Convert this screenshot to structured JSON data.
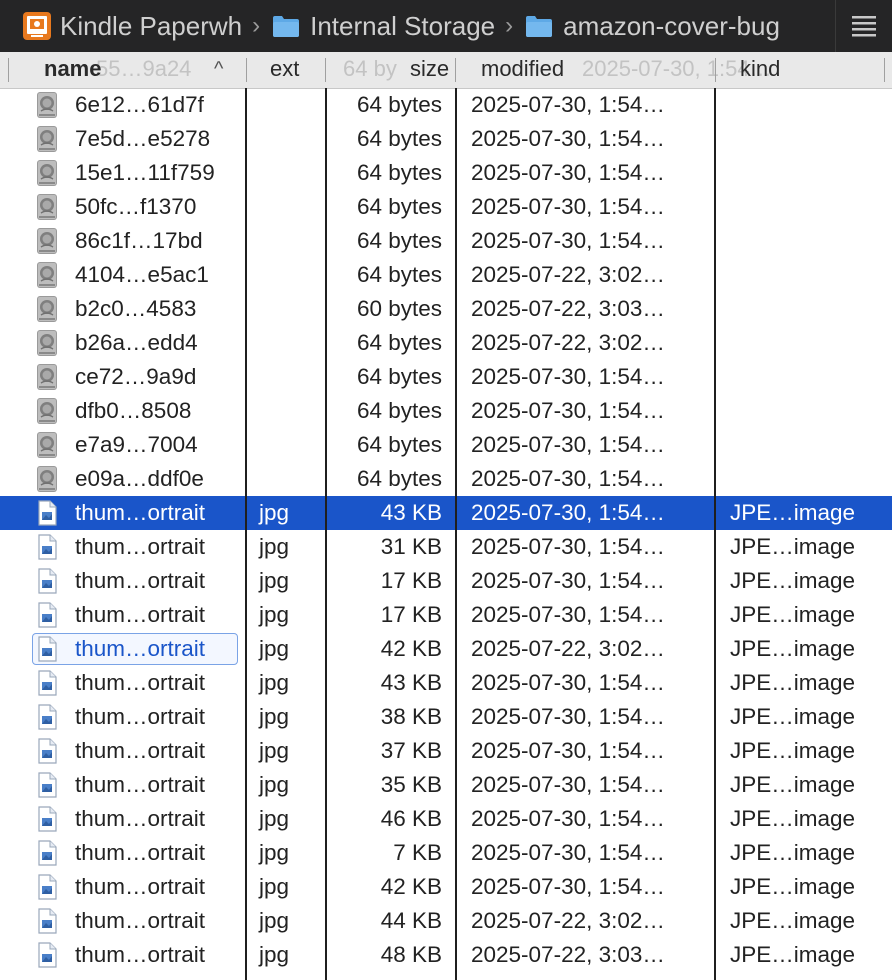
{
  "pathbar": {
    "crumbs": [
      {
        "label": "Kindle Paperwh",
        "icon": "kindle-app-icon"
      },
      {
        "label": "Internal Storage",
        "icon": "folder-icon"
      },
      {
        "label": "amazon-cover-bug",
        "icon": "folder-icon"
      }
    ],
    "separator": "›",
    "view_icon": "list-view-icon"
  },
  "header": {
    "name": "name",
    "sort_indicator": "^",
    "ext": "ext",
    "size": "size",
    "modified": "modified",
    "kind": "kind",
    "behind_name": "55…9a24",
    "behind_size": "64 by",
    "behind_modified": "2025-07-30, 1:54…"
  },
  "colors": {
    "selection": "#1a55c9",
    "pathbar_bg": "#252526",
    "header_bg": "#e9e9e9"
  },
  "rows": [
    {
      "icon": "disk-file-icon",
      "name": "6e12…61d7f",
      "ext": "",
      "size": "64 bytes",
      "modified": "2025-07-30, 1:54…",
      "kind": ""
    },
    {
      "icon": "disk-file-icon",
      "name": "7e5d…e5278",
      "ext": "",
      "size": "64 bytes",
      "modified": "2025-07-30, 1:54…",
      "kind": ""
    },
    {
      "icon": "disk-file-icon",
      "name": "15e1…11f759",
      "ext": "",
      "size": "64 bytes",
      "modified": "2025-07-30, 1:54…",
      "kind": ""
    },
    {
      "icon": "disk-file-icon",
      "name": "50fc…f1370",
      "ext": "",
      "size": "64 bytes",
      "modified": "2025-07-30, 1:54…",
      "kind": ""
    },
    {
      "icon": "disk-file-icon",
      "name": "86c1f…17bd",
      "ext": "",
      "size": "64 bytes",
      "modified": "2025-07-30, 1:54…",
      "kind": ""
    },
    {
      "icon": "disk-file-icon",
      "name": "4104…e5ac1",
      "ext": "",
      "size": "64 bytes",
      "modified": "2025-07-22, 3:02…",
      "kind": ""
    },
    {
      "icon": "disk-file-icon",
      "name": "b2c0…4583",
      "ext": "",
      "size": "60 bytes",
      "modified": "2025-07-22, 3:03…",
      "kind": ""
    },
    {
      "icon": "disk-file-icon",
      "name": "b26a…edd4",
      "ext": "",
      "size": "64 bytes",
      "modified": "2025-07-22, 3:02…",
      "kind": ""
    },
    {
      "icon": "disk-file-icon",
      "name": "ce72…9a9d",
      "ext": "",
      "size": "64 bytes",
      "modified": "2025-07-30, 1:54…",
      "kind": ""
    },
    {
      "icon": "disk-file-icon",
      "name": "dfb0…8508",
      "ext": "",
      "size": "64 bytes",
      "modified": "2025-07-30, 1:54…",
      "kind": ""
    },
    {
      "icon": "disk-file-icon",
      "name": "e7a9…7004",
      "ext": "",
      "size": "64 bytes",
      "modified": "2025-07-30, 1:54…",
      "kind": ""
    },
    {
      "icon": "disk-file-icon",
      "name": "e09a…ddf0e",
      "ext": "",
      "size": "64 bytes",
      "modified": "2025-07-30, 1:54…",
      "kind": ""
    },
    {
      "icon": "jpeg-file-icon",
      "name": "thum…ortrait",
      "ext": "jpg",
      "size": "43 KB",
      "modified": "2025-07-30, 1:54…",
      "kind": "JPE…image",
      "selected": true
    },
    {
      "icon": "jpeg-file-icon",
      "name": "thum…ortrait",
      "ext": "jpg",
      "size": "31 KB",
      "modified": "2025-07-30, 1:54…",
      "kind": "JPE…image"
    },
    {
      "icon": "jpeg-file-icon",
      "name": "thum…ortrait",
      "ext": "jpg",
      "size": "17 KB",
      "modified": "2025-07-30, 1:54…",
      "kind": "JPE…image"
    },
    {
      "icon": "jpeg-file-icon",
      "name": "thum…ortrait",
      "ext": "jpg",
      "size": "17 KB",
      "modified": "2025-07-30, 1:54…",
      "kind": "JPE…image"
    },
    {
      "icon": "jpeg-file-icon",
      "name": "thum…ortrait",
      "ext": "jpg",
      "size": "42 KB",
      "modified": "2025-07-22, 3:02…",
      "kind": "JPE…image",
      "focused": true
    },
    {
      "icon": "jpeg-file-icon",
      "name": "thum…ortrait",
      "ext": "jpg",
      "size": "43 KB",
      "modified": "2025-07-30, 1:54…",
      "kind": "JPE…image"
    },
    {
      "icon": "jpeg-file-icon",
      "name": "thum…ortrait",
      "ext": "jpg",
      "size": "38 KB",
      "modified": "2025-07-30, 1:54…",
      "kind": "JPE…image"
    },
    {
      "icon": "jpeg-file-icon",
      "name": "thum…ortrait",
      "ext": "jpg",
      "size": "37 KB",
      "modified": "2025-07-30, 1:54…",
      "kind": "JPE…image"
    },
    {
      "icon": "jpeg-file-icon",
      "name": "thum…ortrait",
      "ext": "jpg",
      "size": "35 KB",
      "modified": "2025-07-30, 1:54…",
      "kind": "JPE…image"
    },
    {
      "icon": "jpeg-file-icon",
      "name": "thum…ortrait",
      "ext": "jpg",
      "size": "46 KB",
      "modified": "2025-07-30, 1:54…",
      "kind": "JPE…image"
    },
    {
      "icon": "jpeg-file-icon",
      "name": "thum…ortrait",
      "ext": "jpg",
      "size": "7 KB",
      "modified": "2025-07-30, 1:54…",
      "kind": "JPE…image"
    },
    {
      "icon": "jpeg-file-icon",
      "name": "thum…ortrait",
      "ext": "jpg",
      "size": "42 KB",
      "modified": "2025-07-30, 1:54…",
      "kind": "JPE…image"
    },
    {
      "icon": "jpeg-file-icon",
      "name": "thum…ortrait",
      "ext": "jpg",
      "size": "44 KB",
      "modified": "2025-07-22, 3:02…",
      "kind": "JPE…image"
    },
    {
      "icon": "jpeg-file-icon",
      "name": "thum…ortrait",
      "ext": "jpg",
      "size": "48 KB",
      "modified": "2025-07-22, 3:03…",
      "kind": "JPE…image"
    }
  ]
}
